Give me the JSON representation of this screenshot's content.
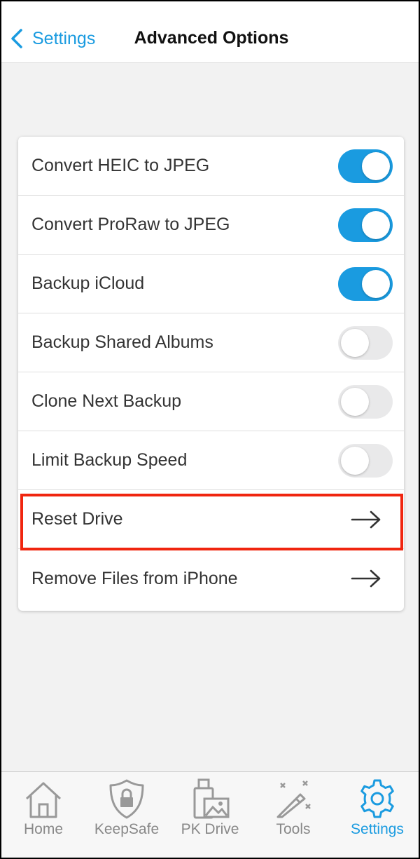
{
  "header": {
    "back_label": "Settings",
    "title": "Advanced Options"
  },
  "options": [
    {
      "label": "Convert HEIC to JPEG",
      "control": "toggle",
      "state": "on"
    },
    {
      "label": "Convert ProRaw to JPEG",
      "control": "toggle",
      "state": "on"
    },
    {
      "label": "Backup iCloud",
      "control": "toggle",
      "state": "on"
    },
    {
      "label": "Backup Shared Albums",
      "control": "toggle",
      "state": "off"
    },
    {
      "label": "Clone Next Backup",
      "control": "toggle",
      "state": "off"
    },
    {
      "label": "Limit Backup Speed",
      "control": "toggle",
      "state": "off"
    },
    {
      "label": "Reset Drive",
      "control": "arrow",
      "highlighted": true
    },
    {
      "label": "Remove Files from iPhone",
      "control": "arrow"
    }
  ],
  "tabs": [
    {
      "label": "Home",
      "icon": "home-icon",
      "active": false
    },
    {
      "label": "KeepSafe",
      "icon": "shield-lock-icon",
      "active": false
    },
    {
      "label": "PK Drive",
      "icon": "drive-photo-icon",
      "active": false
    },
    {
      "label": "Tools",
      "icon": "magic-wand-icon",
      "active": false
    },
    {
      "label": "Settings",
      "icon": "gear-icon",
      "active": true
    }
  ],
  "colors": {
    "accent": "#1a9be0",
    "highlight": "#f0250f",
    "toggle_off": "#e9e9ea",
    "tab_inactive": "#888888"
  }
}
